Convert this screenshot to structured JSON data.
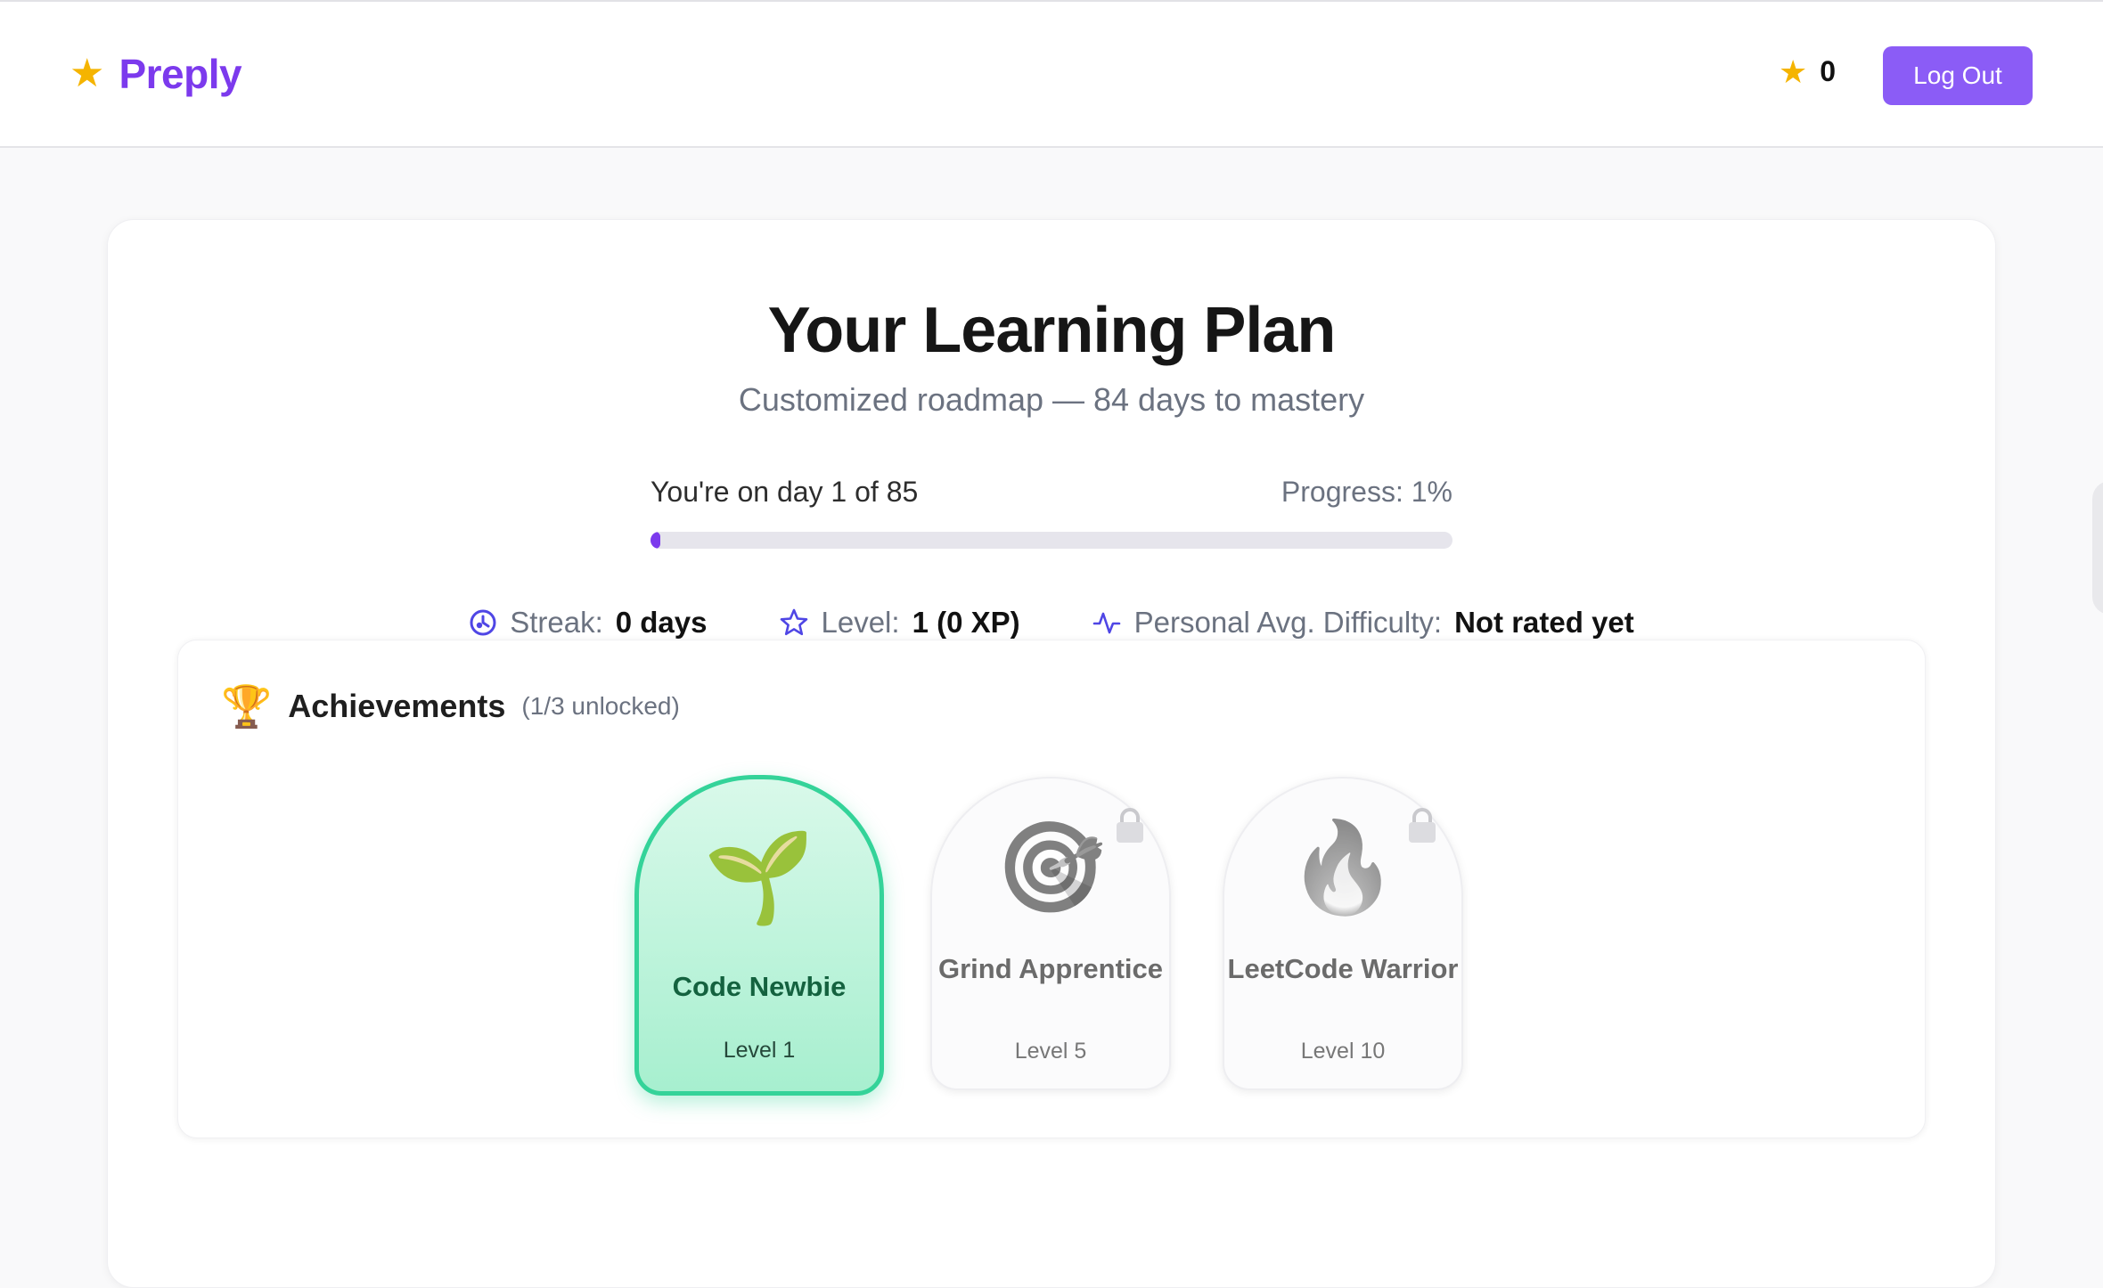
{
  "header": {
    "brand": "Preply",
    "stars": "0",
    "logout_label": "Log Out",
    "icons": {
      "brand": "star-icon",
      "stars": "star-icon"
    }
  },
  "plan": {
    "title": "Your Learning Plan",
    "subtitle": "Customized roadmap — 84 days to mastery",
    "day_text": "You're on day 1 of 85",
    "progress_text": "Progress: 1%",
    "progress_fraction": 0.01
  },
  "stats": [
    {
      "icon": "streak-icon",
      "label": "Streak:",
      "value": "0 days"
    },
    {
      "icon": "star-outline-icon",
      "label": "Level:",
      "value": "1 (0 XP)"
    },
    {
      "icon": "activity-icon",
      "label": "Personal Avg. Difficulty:",
      "value": "Not rated yet"
    }
  ],
  "achievements": {
    "title": "Achievements",
    "count": "(1/3 unlocked)",
    "badges": [
      {
        "name": "Code Newbie",
        "level": "Level 1",
        "emoji": "🌱",
        "unlocked": true
      },
      {
        "name": "Grind Apprentice",
        "level": "Level 5",
        "emoji": "🎯",
        "unlocked": false
      },
      {
        "name": "LeetCode Warrior",
        "level": "Level 10",
        "emoji": "🔥",
        "unlocked": false
      }
    ]
  },
  "colors": {
    "brand": "#7c3aed",
    "button": "#8b5cf6",
    "unlocked_border": "#34d399",
    "stat_icon": "#4f46e5"
  }
}
